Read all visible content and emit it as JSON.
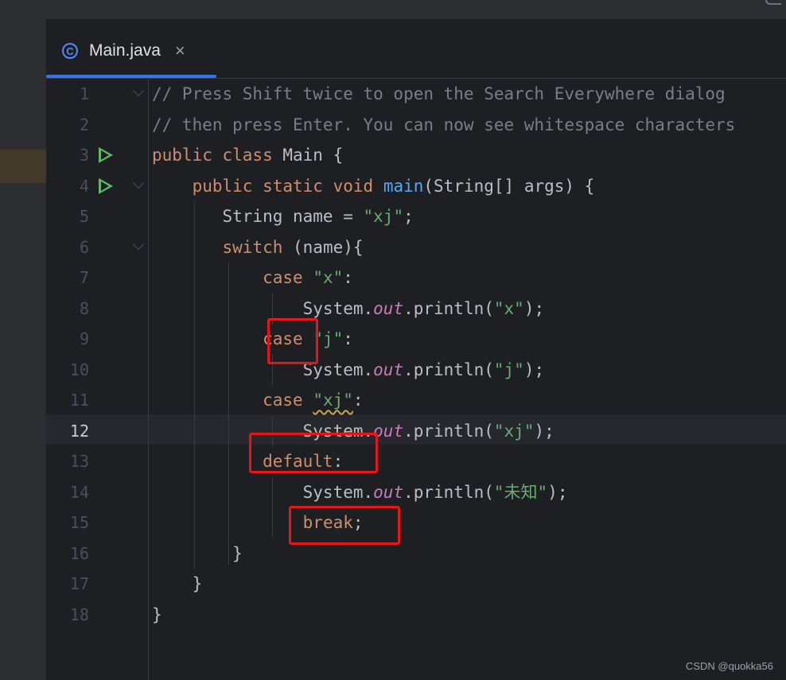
{
  "tab": {
    "icon": "class-c-icon",
    "label": "Main.java",
    "close": "×"
  },
  "current_line": "12",
  "lines": [
    {
      "num": "1",
      "tokens": [
        {
          "t": "// Press Shift twice to open the Search Everywhere dialog",
          "c": "cmt"
        }
      ]
    },
    {
      "num": "2",
      "tokens": [
        {
          "t": "// then press Enter. You can now see whitespace characters",
          "c": "cmt"
        }
      ]
    },
    {
      "num": "3",
      "tokens": [
        {
          "t": "public class",
          "c": "kw"
        },
        {
          "t": " Main {",
          "c": ""
        }
      ]
    },
    {
      "num": "4",
      "tokens": [
        {
          "t": "    ",
          "c": ""
        },
        {
          "t": "public static void",
          "c": "kw"
        },
        {
          "t": " ",
          "c": ""
        },
        {
          "t": "main",
          "c": "fn"
        },
        {
          "t": "(String[] args) {",
          "c": ""
        }
      ]
    },
    {
      "num": "5",
      "tokens": [
        {
          "t": "       String name = ",
          "c": ""
        },
        {
          "t": "\"xj\"",
          "c": "str"
        },
        {
          "t": ";",
          "c": ""
        }
      ]
    },
    {
      "num": "6",
      "tokens": [
        {
          "t": "       ",
          "c": ""
        },
        {
          "t": "switch",
          "c": "kw"
        },
        {
          "t": " (name){",
          "c": ""
        }
      ]
    },
    {
      "num": "7",
      "tokens": [
        {
          "t": "           ",
          "c": ""
        },
        {
          "t": "case",
          "c": "kw"
        },
        {
          "t": " ",
          "c": ""
        },
        {
          "t": "\"x\"",
          "c": "str"
        },
        {
          "t": ":",
          "c": ""
        }
      ]
    },
    {
      "num": "8",
      "tokens": [
        {
          "t": "               System.",
          "c": ""
        },
        {
          "t": "out",
          "c": "fld"
        },
        {
          "t": ".println(",
          "c": ""
        },
        {
          "t": "\"x\"",
          "c": "str"
        },
        {
          "t": ");",
          "c": ""
        }
      ]
    },
    {
      "num": "9",
      "tokens": [
        {
          "t": "           ",
          "c": ""
        },
        {
          "t": "case",
          "c": "kw"
        },
        {
          "t": " ",
          "c": ""
        },
        {
          "t": "\"j\"",
          "c": "str"
        },
        {
          "t": ":",
          "c": ""
        }
      ]
    },
    {
      "num": "10",
      "tokens": [
        {
          "t": "               System.",
          "c": ""
        },
        {
          "t": "out",
          "c": "fld"
        },
        {
          "t": ".println(",
          "c": ""
        },
        {
          "t": "\"j\"",
          "c": "str"
        },
        {
          "t": ");",
          "c": ""
        }
      ]
    },
    {
      "num": "11",
      "tokens": [
        {
          "t": "           ",
          "c": ""
        },
        {
          "t": "case",
          "c": "kw"
        },
        {
          "t": " ",
          "c": ""
        },
        {
          "t": "\"xj\"",
          "c": "str wavy"
        },
        {
          "t": ":",
          "c": ""
        }
      ]
    },
    {
      "num": "12",
      "tokens": [
        {
          "t": "               System.",
          "c": ""
        },
        {
          "t": "out",
          "c": "fld"
        },
        {
          "t": ".println(",
          "c": ""
        },
        {
          "t": "\"xj\"",
          "c": "str"
        },
        {
          "t": ");",
          "c": ""
        }
      ]
    },
    {
      "num": "13",
      "tokens": [
        {
          "t": "           ",
          "c": ""
        },
        {
          "t": "default",
          "c": "kw"
        },
        {
          "t": ":",
          "c": ""
        }
      ]
    },
    {
      "num": "14",
      "tokens": [
        {
          "t": "               System.",
          "c": ""
        },
        {
          "t": "out",
          "c": "fld"
        },
        {
          "t": ".println(",
          "c": ""
        },
        {
          "t": "\"未知\"",
          "c": "str"
        },
        {
          "t": ");",
          "c": ""
        }
      ]
    },
    {
      "num": "15",
      "tokens": [
        {
          "t": "               ",
          "c": ""
        },
        {
          "t": "break",
          "c": "kw"
        },
        {
          "t": ";",
          "c": ""
        }
      ]
    },
    {
      "num": "16",
      "tokens": [
        {
          "t": "        }",
          "c": ""
        }
      ]
    },
    {
      "num": "17",
      "tokens": [
        {
          "t": "    }",
          "c": ""
        }
      ]
    },
    {
      "num": "18",
      "tokens": [
        {
          "t": "}",
          "c": ""
        }
      ]
    }
  ],
  "run_icon_lines": [
    "3",
    "4"
  ],
  "fold_icon_lines": [
    "1",
    "4",
    "6"
  ],
  "annotation_color": "#e8141a",
  "watermark": "CSDN @quokka56"
}
